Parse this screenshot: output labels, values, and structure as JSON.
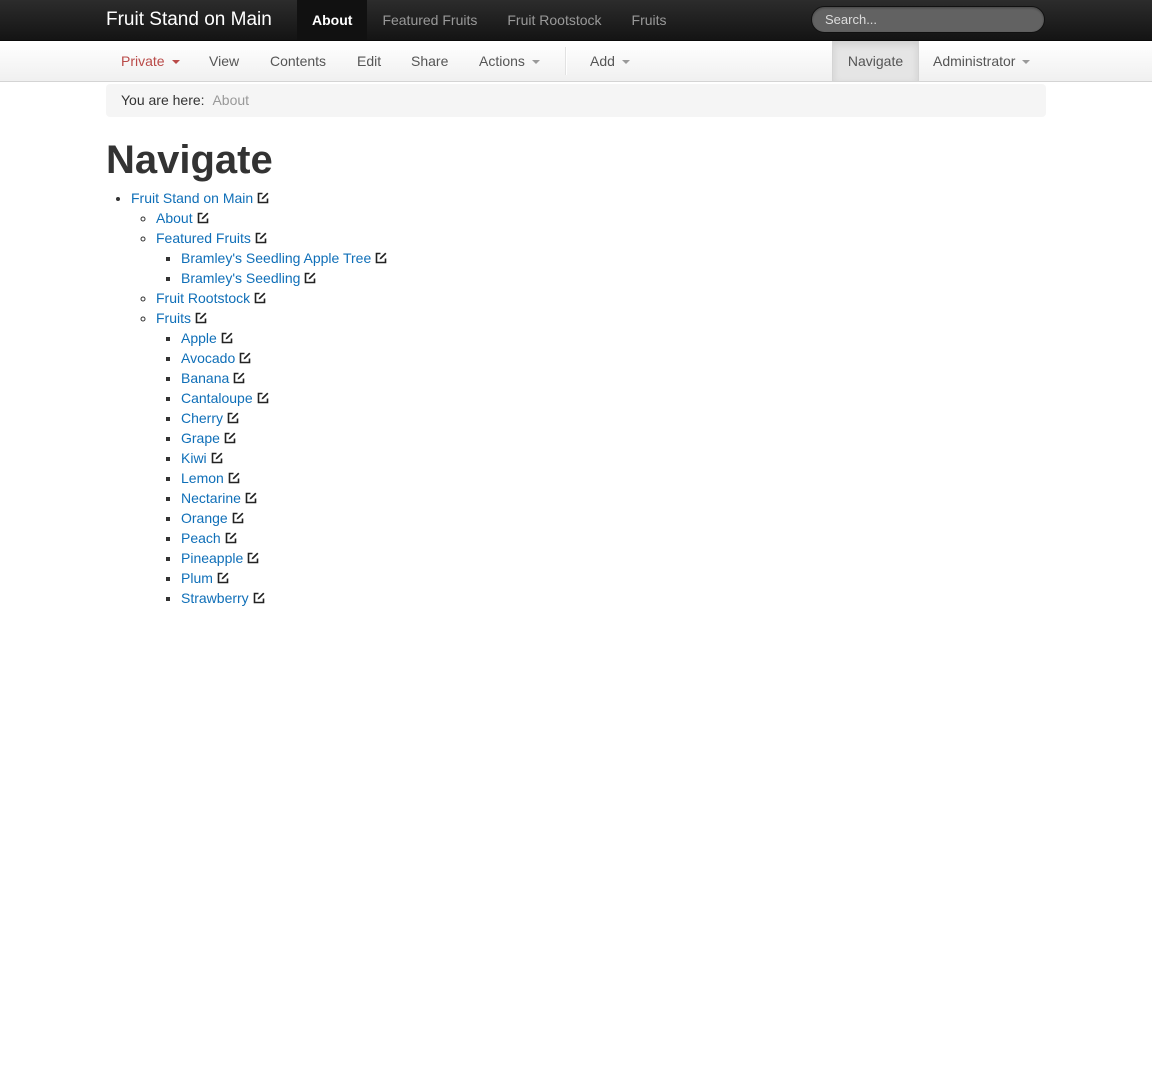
{
  "header": {
    "brand": "Fruit Stand on Main",
    "nav": [
      "About",
      "Featured Fruits",
      "Fruit Rootstock",
      "Fruits"
    ],
    "search_placeholder": "Search..."
  },
  "toolbar": {
    "state": "Private",
    "view": "View",
    "contents": "Contents",
    "edit": "Edit",
    "share": "Share",
    "actions": "Actions",
    "add": "Add",
    "navigate": "Navigate",
    "user": "Administrator"
  },
  "breadcrumb": {
    "label": "You are here:",
    "current": "About"
  },
  "page": {
    "title": "Navigate"
  },
  "tree": {
    "root": "Fruit Stand on Main",
    "about": "About",
    "featured": {
      "label": "Featured Fruits",
      "children": [
        "Bramley's Seedling Apple Tree",
        "Bramley's Seedling"
      ]
    },
    "rootstock": "Fruit Rootstock",
    "fruits": {
      "label": "Fruits",
      "children": [
        "Apple",
        "Avocado",
        "Banana",
        "Cantaloupe",
        "Cherry",
        "Grape",
        "Kiwi",
        "Lemon",
        "Nectarine",
        "Orange",
        "Peach",
        "Pineapple",
        "Plum",
        "Strawberry"
      ]
    }
  },
  "colors": {
    "link": "#0f6fb8",
    "state_private": "#b94a48",
    "navbar_bg": "#1b1b1b"
  }
}
